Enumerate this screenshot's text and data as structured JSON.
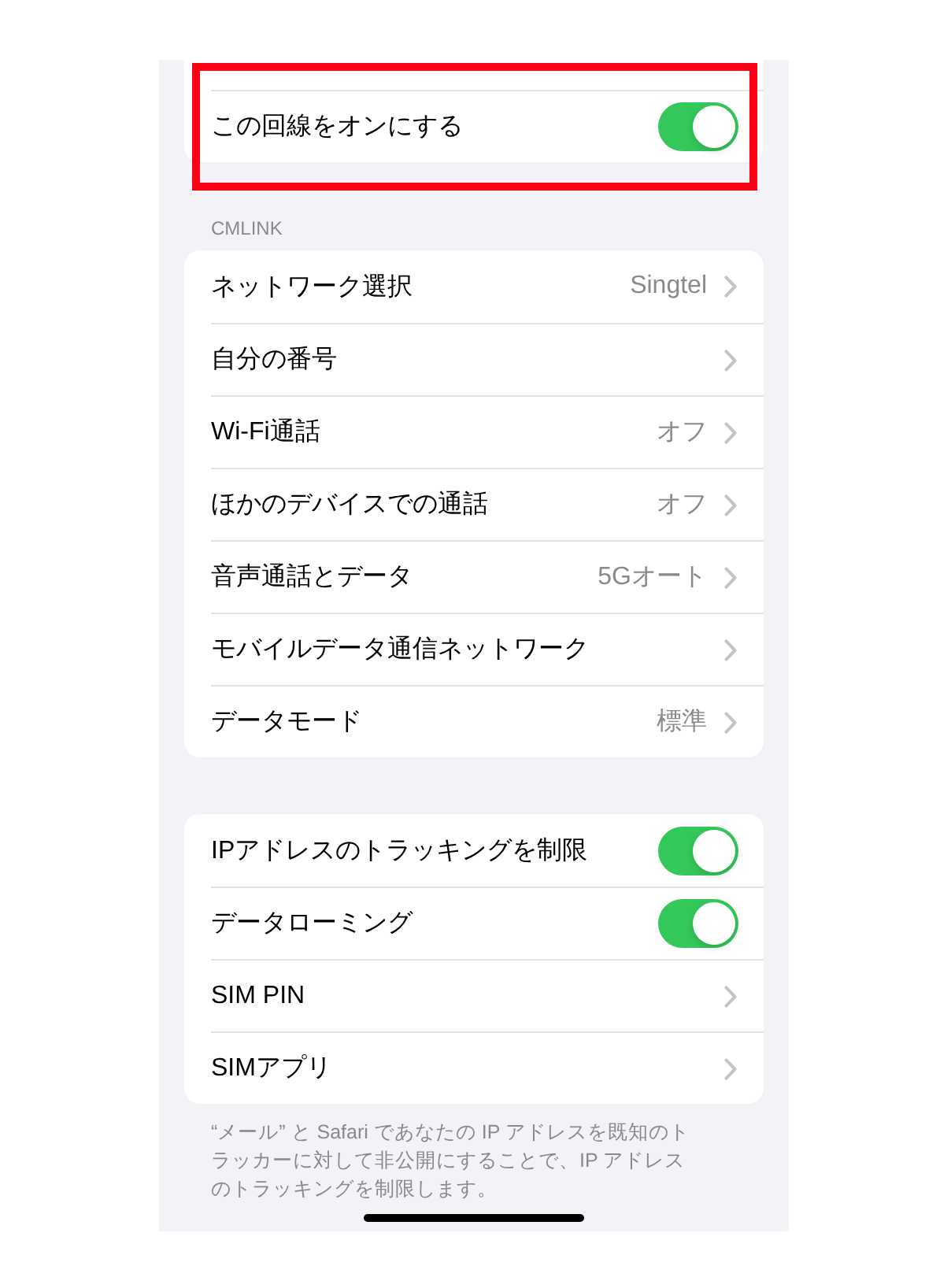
{
  "groups": [
    {
      "highlighted": true,
      "rows": [
        {
          "kind": "toggle",
          "label": "この回線をオンにする",
          "on": true
        }
      ]
    },
    {
      "header": "CMLINK",
      "highlighted": false,
      "rows": [
        {
          "kind": "link",
          "label": "ネットワーク選択",
          "value": "Singtel"
        },
        {
          "kind": "link",
          "label": "自分の番号"
        },
        {
          "kind": "link",
          "label": "Wi-Fi通話",
          "value": "オフ"
        },
        {
          "kind": "link",
          "label": "ほかのデバイスでの通話",
          "value": "オフ"
        },
        {
          "kind": "link",
          "label": "音声通話とデータ",
          "value": "5Gオート"
        },
        {
          "kind": "link",
          "label": "モバイルデータ通信ネットワーク"
        },
        {
          "kind": "link",
          "label": "データモード",
          "value": "標準"
        }
      ]
    },
    {
      "highlighted": false,
      "rows": [
        {
          "kind": "toggle",
          "label": "IPアドレスのトラッキングを制限",
          "on": true
        },
        {
          "kind": "toggle",
          "label": "データローミング",
          "on": true
        },
        {
          "kind": "link",
          "label": "SIM PIN"
        },
        {
          "kind": "link",
          "label": "SIMアプリ"
        }
      ],
      "footer": "“メール” と Safari であなたの IP アドレスを既知のトラッカーに対して非公開にすることで、IP アドレスのトラッキングを制限します。"
    }
  ]
}
